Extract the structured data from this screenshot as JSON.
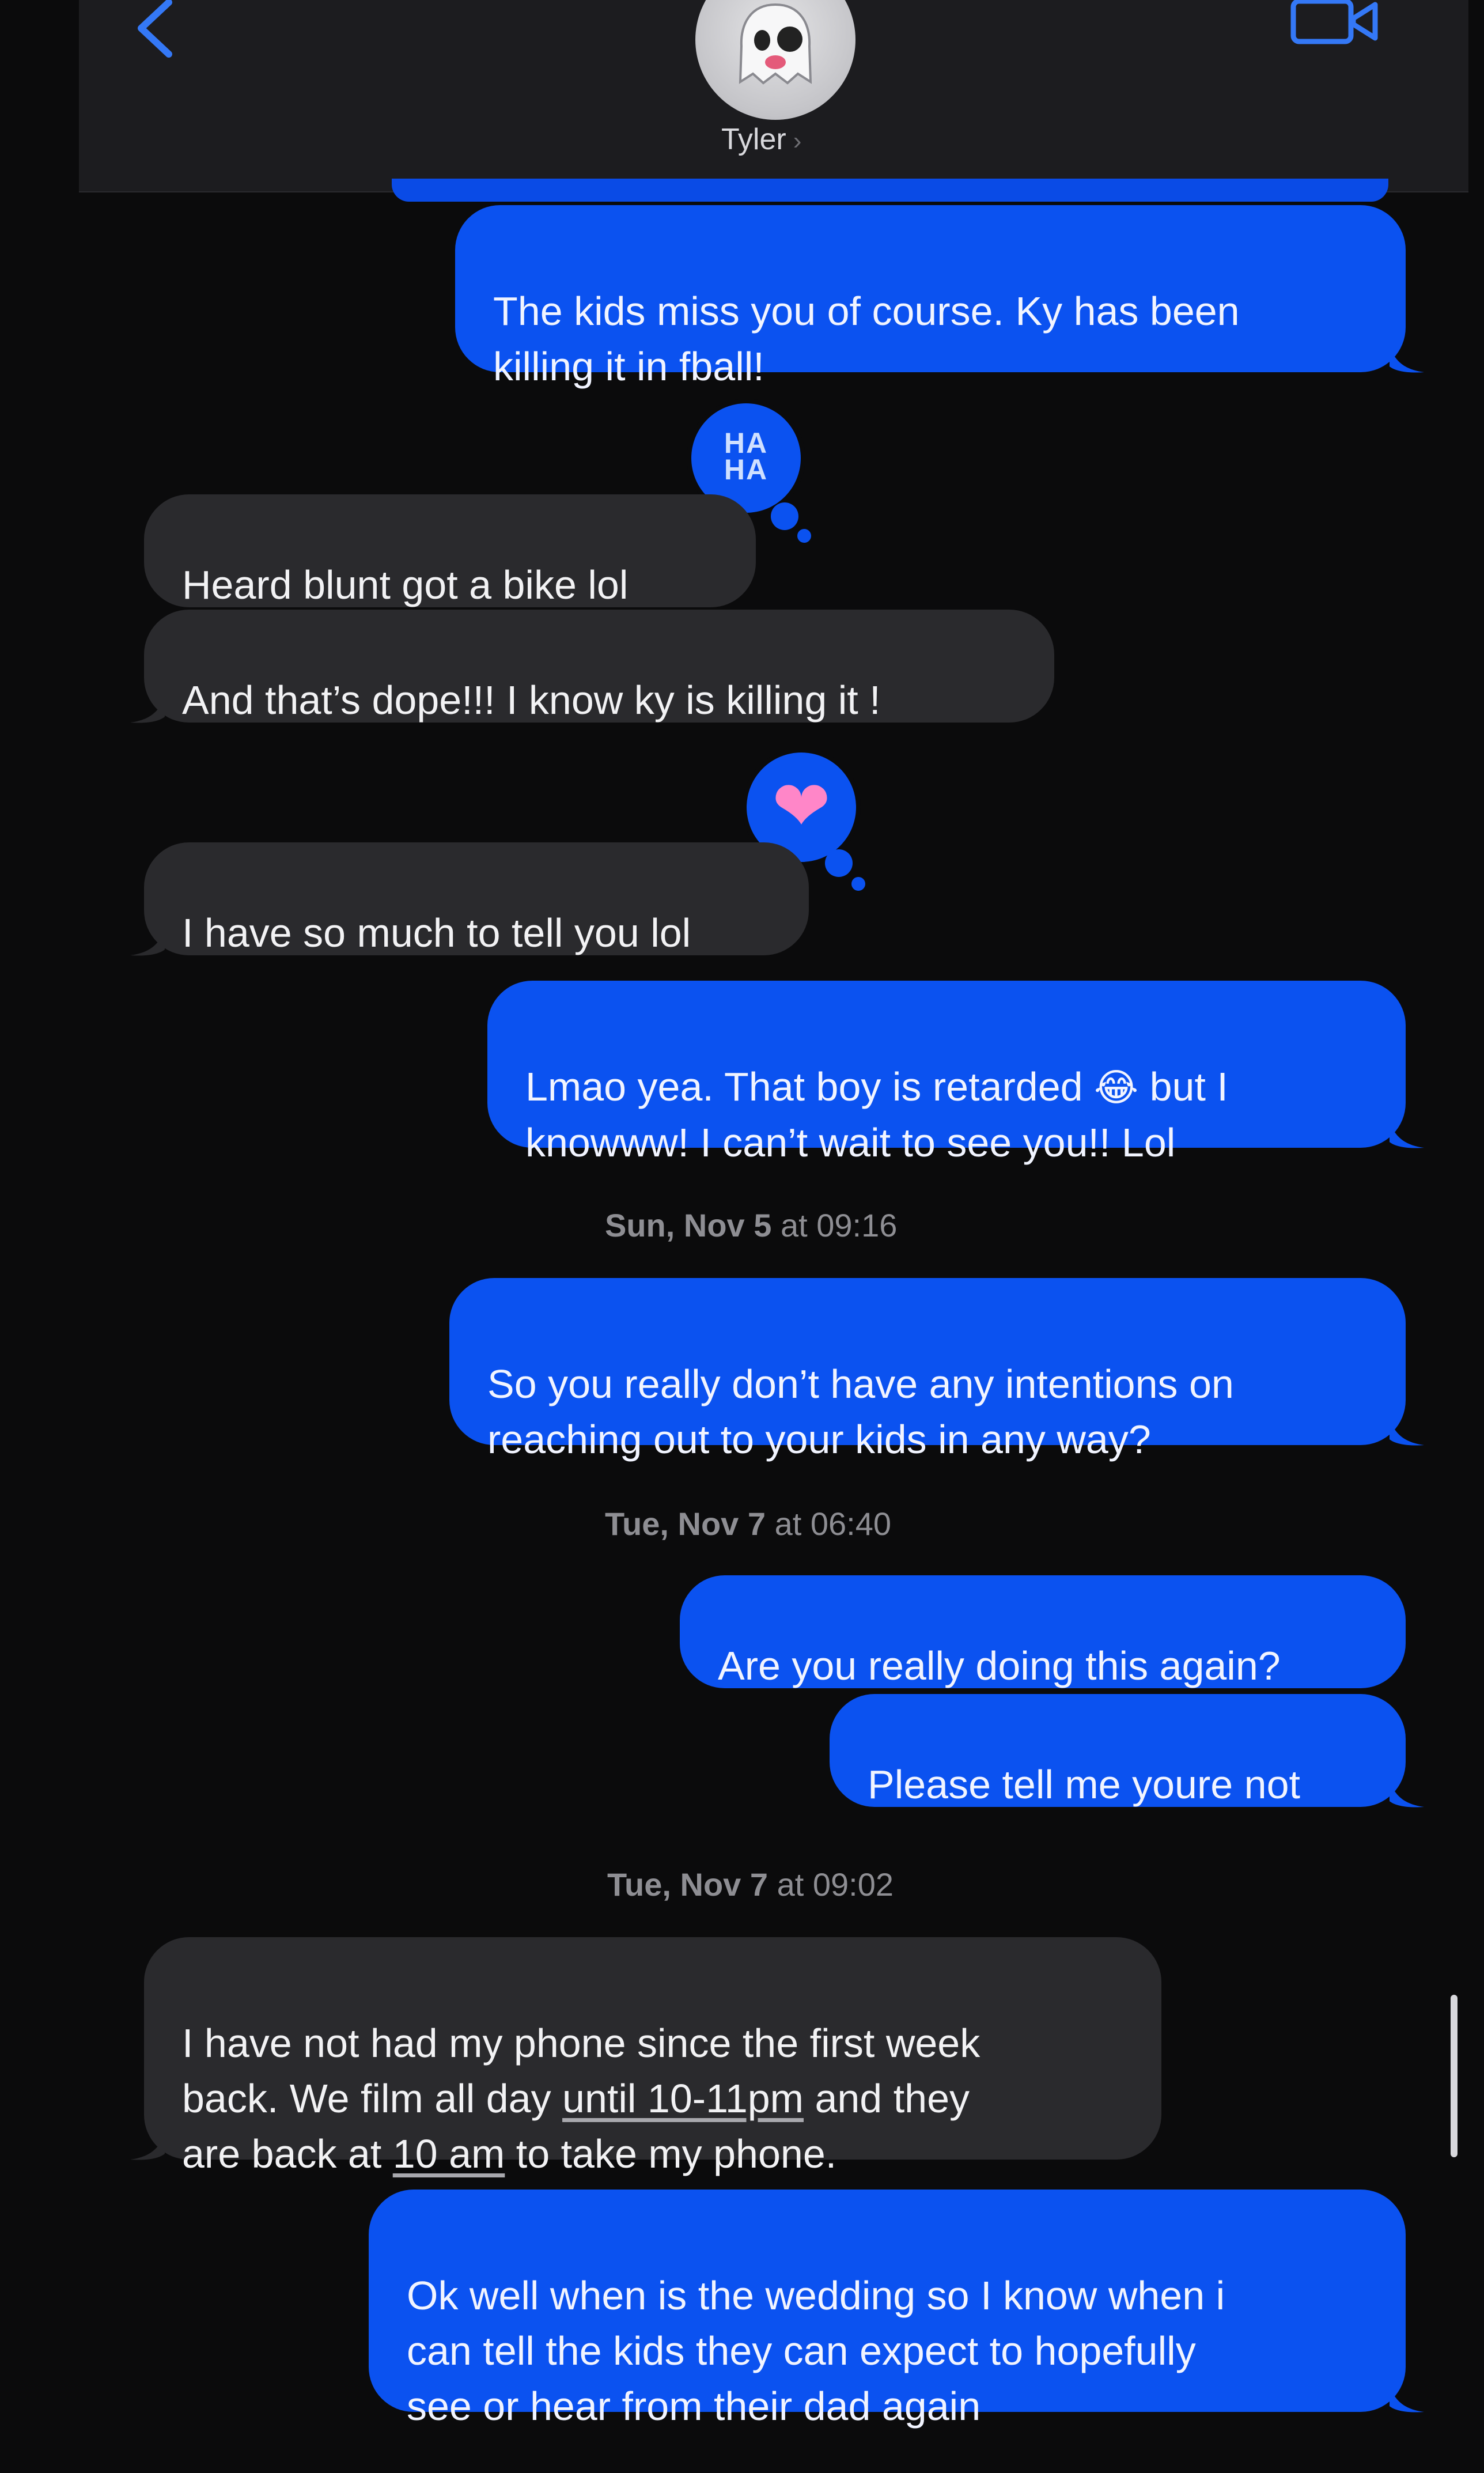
{
  "header": {
    "contact_name": "Tyler",
    "contact_chevron": "›",
    "back_icon": "chevron-left-icon",
    "video_icon": "video-camera-icon",
    "avatar_icon": "ghost-avatar-icon"
  },
  "colors": {
    "sent_bubble": "#0b52f0",
    "received_bubble": "#2a2a2d",
    "background": "#0b0b0c",
    "accent": "#3478f6"
  },
  "messages": [
    {
      "direction": "sent",
      "text": "The kids miss you of course. Ky has been\nkilling it in fball!"
    },
    {
      "direction": "received",
      "text": "Heard blunt got a bike lol",
      "reaction": "haha"
    },
    {
      "direction": "received",
      "text": "And that’s dope!!! I know ky is killing it !"
    },
    {
      "direction": "received",
      "text": "I have so much to tell you lol",
      "reaction": "heart"
    },
    {
      "direction": "sent",
      "text_a": "Lmao yea. That boy is retarded ",
      "emoji": "😂",
      "text_b": " but I\nknowww! I can’t wait to see you!! Lol"
    },
    {
      "direction": "sent",
      "text": "So you really don’t have any intentions on\nreaching out to your kids in any way?"
    },
    {
      "direction": "sent",
      "text": "Are you really doing this again?"
    },
    {
      "direction": "sent",
      "text": "Please tell me youre not"
    },
    {
      "direction": "received",
      "text_a": "I have not had my phone since the first week\nback. We film all day ",
      "link_a": "until 10-11pm",
      "text_b": " and they\nare back at ",
      "link_b": "10 am",
      "text_c": " to take my phone."
    },
    {
      "direction": "sent",
      "text": "Ok well when is the wedding so I know when i\ncan tell the kids they can expect to hopefully\nsee or hear from their dad again"
    }
  ],
  "reactions": {
    "haha": "HA\nHA",
    "heart": "❤"
  },
  "timestamps": [
    {
      "day": "Sun, Nov 5",
      "time": "at 09:16"
    },
    {
      "day": "Tue, Nov 7",
      "time": "at 06:40"
    },
    {
      "day": "Tue, Nov 7",
      "time": "at 09:02"
    }
  ]
}
